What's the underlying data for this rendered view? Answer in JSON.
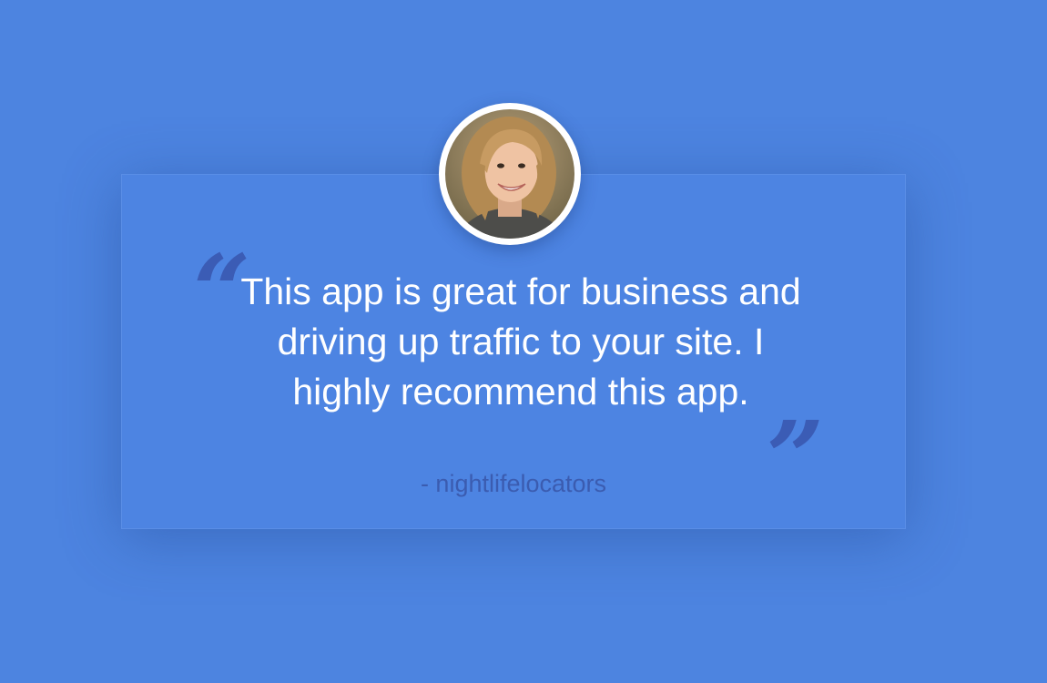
{
  "testimonial": {
    "quote": "This app is great for business and driving up traffic to your site. I highly recommend this app.",
    "author": "- nightlifelocators",
    "open_quote_mark": "“",
    "close_quote_mark": "”"
  },
  "colors": {
    "background": "#4d84e0",
    "card": "#4d84e2",
    "quote_marks": "#3b5cb5",
    "author_text": "#3b5cb0",
    "quote_text": "#ffffff"
  }
}
